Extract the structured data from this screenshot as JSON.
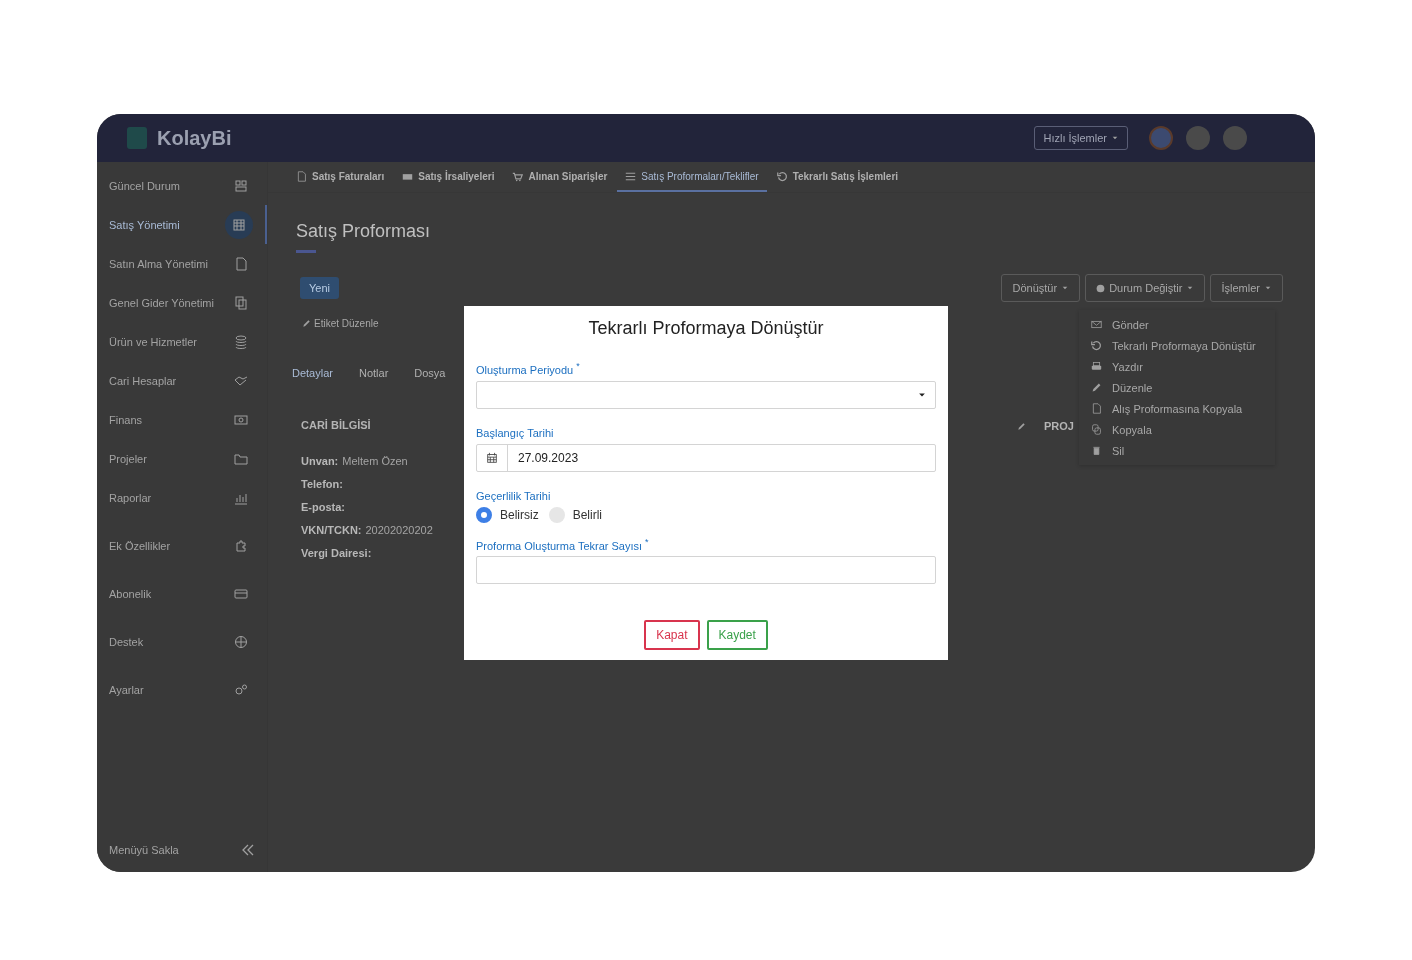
{
  "topbar": {
    "logo": "KolayBi",
    "quick_actions": "Hızlı İşlemler"
  },
  "sidebar": {
    "items": [
      {
        "label": "Güncel Durum",
        "selected": false
      },
      {
        "label": "Satış Yönetimi",
        "selected": true
      },
      {
        "label": "Satın Alma Yönetimi",
        "selected": false
      },
      {
        "label": "Genel Gider Yönetimi",
        "selected": false
      },
      {
        "label": "Ürün ve Hizmetler",
        "selected": false
      },
      {
        "label": "Cari Hesaplar",
        "selected": false
      },
      {
        "label": "Finans",
        "selected": false
      },
      {
        "label": "Projeler",
        "selected": false
      },
      {
        "label": "Raporlar",
        "selected": false
      },
      {
        "label": "Ek Özellikler",
        "selected": false
      },
      {
        "label": "Abonelik",
        "selected": false
      },
      {
        "label": "Destek",
        "selected": false
      },
      {
        "label": "Ayarlar",
        "selected": false
      }
    ],
    "collapse": "Menüyü Sakla"
  },
  "tabs": [
    {
      "label": "Satış Faturaları",
      "selected": false
    },
    {
      "label": "Satış İrsaliyeleri",
      "selected": false
    },
    {
      "label": "Alınan Siparişler",
      "selected": false
    },
    {
      "label": "Satış Proformaları/Teklifler",
      "selected": true
    },
    {
      "label": "Tekrarlı Satış İşlemleri",
      "selected": false
    }
  ],
  "page": {
    "title": "Satış Proforması",
    "new_button": "Yeni",
    "edit_tags": "Etiket Düzenle",
    "actions": [
      "Dönüştür",
      "Durum Değiştir",
      "İşlemler"
    ],
    "detail_tabs": [
      {
        "label": "Detaylar",
        "selected": true
      },
      {
        "label": "Notlar",
        "selected": false
      },
      {
        "label": "Dosya",
        "selected": false
      }
    ],
    "section_title": "CARİ BİLGİSİ",
    "fields": [
      {
        "label": "Unvan:",
        "value": "Meltem Özen"
      },
      {
        "label": "Telefon:"
      },
      {
        "label": "E-posta:"
      },
      {
        "label": "VKN/TCKN:",
        "value": "20202020202"
      },
      {
        "label": "Vergi Dairesi:"
      }
    ],
    "side_header": "PROJ"
  },
  "menu": [
    "Gönder",
    "Tekrarlı Proformaya Dönüştür",
    "Yazdır",
    "Düzenle",
    "Alış Proformasına Kopyala",
    "Kopyala",
    "Sil"
  ],
  "dialog": {
    "title": "Tekrarlı Proformaya Dönüştür",
    "fields": [
      {
        "kind": "select",
        "label": "Oluşturma Periyodu",
        "required_mark": "*"
      },
      {
        "kind": "date",
        "label": "Başlangıç Tarihi",
        "value": "27.09.2023"
      },
      {
        "kind": "radio",
        "label": "Geçerlilik Tarihi",
        "options": [
          {
            "label": "Belirsiz",
            "selected": true
          },
          {
            "label": "Belirli",
            "selected": false
          }
        ]
      },
      {
        "kind": "text",
        "label": "Proforma Oluşturma Tekrar Sayısı",
        "required_mark": "*"
      }
    ],
    "buttons": [
      {
        "kind": "cancel",
        "label": "Kapat"
      },
      {
        "kind": "save",
        "label": "Kaydet"
      }
    ]
  }
}
